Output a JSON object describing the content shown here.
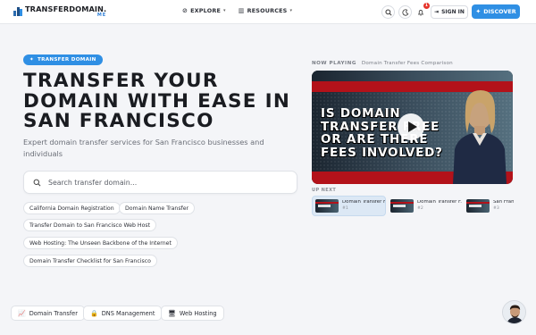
{
  "header": {
    "logo_main": "TRANSFERDOMAIN.",
    "logo_sub": "ME",
    "nav": [
      {
        "label": "EXPLORE",
        "icon": "compass-icon"
      },
      {
        "label": "RESOURCES",
        "icon": "books-icon"
      }
    ],
    "notification_count": "1",
    "signin_label": "SIGN IN",
    "discover_label": "DISCOVER"
  },
  "hero": {
    "pill_label": "TRANSFER DOMAIN",
    "title": "TRANSFER YOUR DOMAIN WITH EASE IN SAN FRANCISCO",
    "subtitle": "Expert domain transfer services for San Francisco businesses and individuals",
    "search_placeholder": "Search transfer domain..."
  },
  "chips": [
    "California Domain Registration",
    "Domain Name Transfer",
    "Transfer Domain to San Francisco Web Host",
    "Web Hosting: The Unseen Backbone of the Internet",
    "Domain Transfer Checklist for San Francisco"
  ],
  "bottom_tags": [
    {
      "label": "Domain Transfer",
      "icon": "chart-icon"
    },
    {
      "label": "DNS Management",
      "icon": "lock-icon"
    },
    {
      "label": "Web Hosting",
      "icon": "monitor-icon"
    }
  ],
  "video": {
    "now_playing_label": "NOW PLAYING",
    "now_playing_title": "Domain Transfer Fees Comparison",
    "caption": "IS DOMAIN TRANSFER FREE OR ARE THERE FEES INVOLVED?",
    "up_next_label": "UP NEXT",
    "up_next": [
      {
        "title": "Domain Transfer F...",
        "num": "#1"
      },
      {
        "title": "Domain Transfer F...",
        "num": "#2"
      },
      {
        "title": "San Franc...",
        "num": "#3"
      }
    ]
  },
  "colors": {
    "accent": "#2f8fe4",
    "notification": "#e5332a",
    "video_red": "#b3121a"
  }
}
